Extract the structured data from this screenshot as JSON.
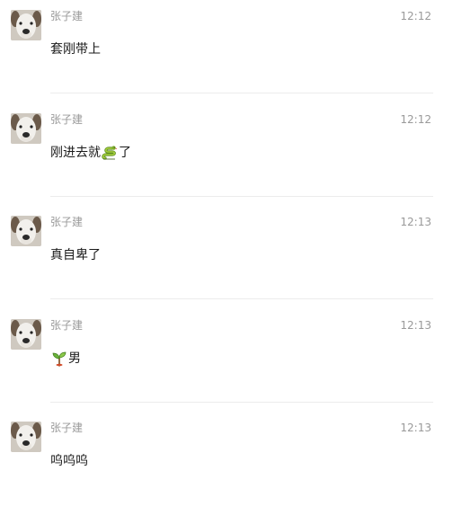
{
  "messages": [
    {
      "sender": "张子建",
      "time": "12:12",
      "text_before": "套刚带上",
      "emoji": "",
      "text_after": ""
    },
    {
      "sender": "张子建",
      "time": "12:12",
      "text_before": "刚进去就",
      "emoji": "snake-emoji",
      "text_after": "了"
    },
    {
      "sender": "张子建",
      "time": "12:13",
      "text_before": "真自卑了",
      "emoji": "",
      "text_after": ""
    },
    {
      "sender": "张子建",
      "time": "12:13",
      "text_before": "",
      "emoji": "sprout-emoji",
      "text_after": "男"
    },
    {
      "sender": "张子建",
      "time": "12:13",
      "text_before": "呜呜呜",
      "emoji": "",
      "text_after": ""
    }
  ],
  "colors": {
    "meta_text": "#9a9a9a",
    "body_text": "#1a1a1a",
    "divider": "#ececec"
  }
}
